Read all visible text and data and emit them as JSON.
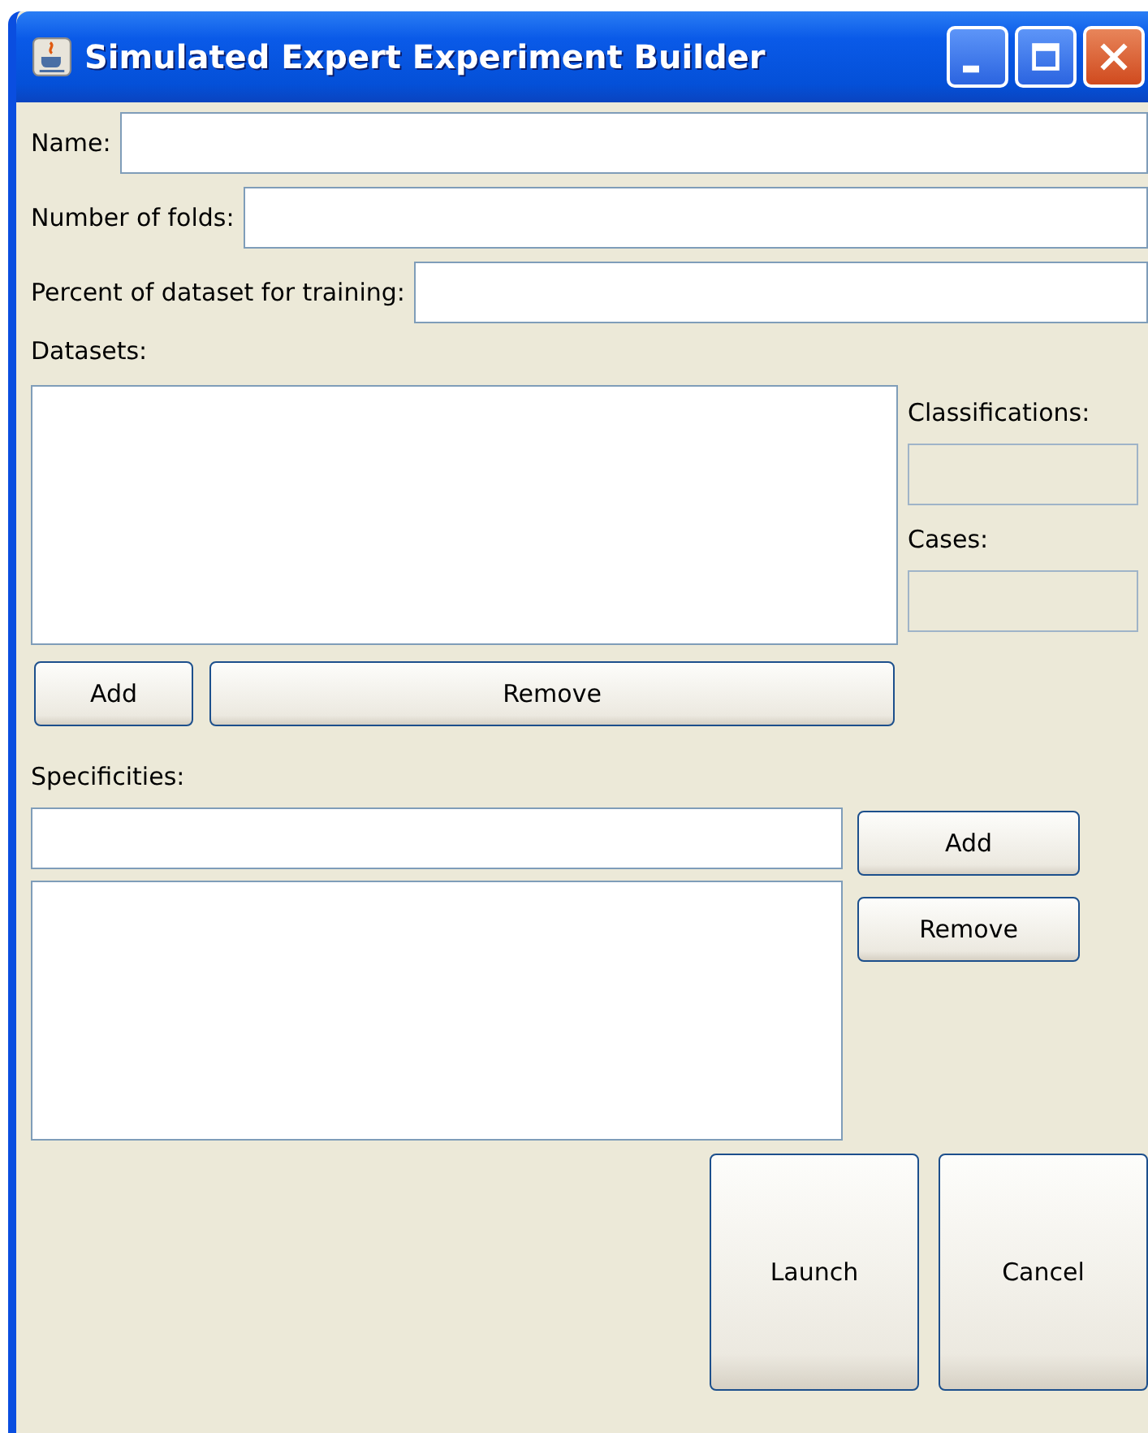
{
  "window": {
    "title": "Simulated Expert Experiment Builder"
  },
  "fields": [
    {
      "label": "Name:"
    },
    {
      "label": "Number of folds:"
    },
    {
      "label": "Percent of dataset for training:"
    }
  ],
  "datasets": {
    "label": "Datasets:",
    "buttons": [
      "Add",
      "Remove"
    ]
  },
  "stats": [
    {
      "label": "Classifications:"
    },
    {
      "label": "Cases:"
    }
  ],
  "specificities": {
    "label": "Specificities:",
    "buttons": [
      "Add",
      "Remove"
    ]
  },
  "actions": [
    "Launch",
    "Cancel"
  ]
}
